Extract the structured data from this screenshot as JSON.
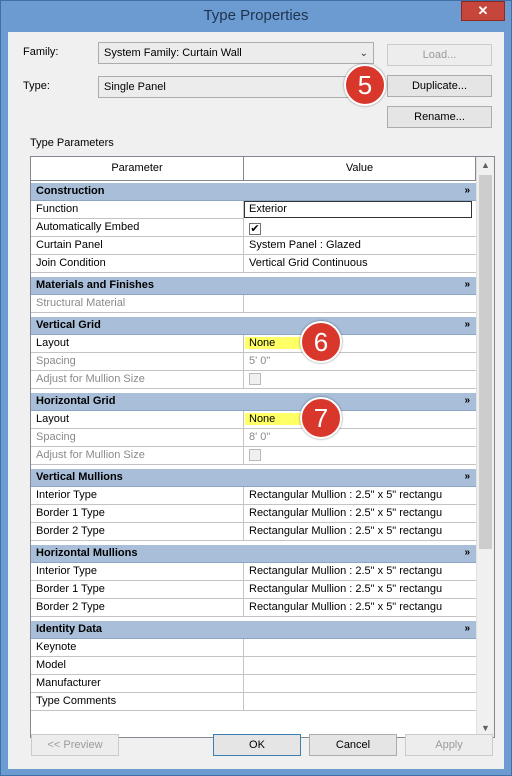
{
  "window": {
    "title": "Type Properties",
    "close_glyph": "✕"
  },
  "family": {
    "label": "Family:",
    "value": "System Family: Curtain Wall",
    "load_label": "Load..."
  },
  "type": {
    "label": "Type:",
    "value": "Single Panel",
    "duplicate_label": "Duplicate...",
    "rename_label": "Rename..."
  },
  "type_parameters_label": "Type Parameters",
  "columns": {
    "parameter": "Parameter",
    "value": "Value"
  },
  "groups": {
    "construction": "Construction",
    "materials": "Materials and Finishes",
    "vgrid": "Vertical Grid",
    "hgrid": "Horizontal Grid",
    "vmullions": "Vertical Mullions",
    "hmullions": "Horizontal Mullions",
    "identity": "Identity Data"
  },
  "rows": {
    "function": {
      "p": "Function",
      "v": "Exterior"
    },
    "auto_embed": {
      "p": "Automatically Embed",
      "v": "✔"
    },
    "curtain_panel": {
      "p": "Curtain Panel",
      "v": "System Panel : Glazed"
    },
    "join_condition": {
      "p": "Join Condition",
      "v": "Vertical Grid Continuous"
    },
    "structural_material": {
      "p": "Structural Material",
      "v": ""
    },
    "vg_layout": {
      "p": "Layout",
      "v": "None"
    },
    "vg_spacing": {
      "p": "Spacing",
      "v": "5'  0\""
    },
    "vg_adjust": {
      "p": "Adjust for Mullion Size",
      "v": ""
    },
    "hg_layout": {
      "p": "Layout",
      "v": "None"
    },
    "hg_spacing": {
      "p": "Spacing",
      "v": "8'  0\""
    },
    "hg_adjust": {
      "p": "Adjust for Mullion Size",
      "v": ""
    },
    "vm_interior": {
      "p": "Interior Type",
      "v": "Rectangular Mullion : 2.5\" x 5\" rectangu"
    },
    "vm_border1": {
      "p": "Border 1 Type",
      "v": "Rectangular Mullion : 2.5\" x 5\" rectangu"
    },
    "vm_border2": {
      "p": "Border 2 Type",
      "v": "Rectangular Mullion : 2.5\" x 5\" rectangu"
    },
    "hm_interior": {
      "p": "Interior Type",
      "v": "Rectangular Mullion : 2.5\" x 5\" rectangu"
    },
    "hm_border1": {
      "p": "Border 1 Type",
      "v": "Rectangular Mullion : 2.5\" x 5\" rectangu"
    },
    "hm_border2": {
      "p": "Border 2 Type",
      "v": "Rectangular Mullion : 2.5\" x 5\" rectangu"
    },
    "keynote": {
      "p": "Keynote",
      "v": ""
    },
    "model": {
      "p": "Model",
      "v": ""
    },
    "manufacturer": {
      "p": "Manufacturer",
      "v": ""
    },
    "type_comments": {
      "p": "Type Comments",
      "v": ""
    }
  },
  "callouts": {
    "five": "5",
    "six": "6",
    "seven": "7"
  },
  "footer": {
    "preview": "<< Preview",
    "ok": "OK",
    "cancel": "Cancel",
    "apply": "Apply"
  },
  "icons": {
    "collapse": "»",
    "scroll_up": "▲",
    "scroll_down": "▼",
    "combo_arrow": "⌄"
  },
  "colors": {
    "group_header": "#a8bed9",
    "highlight": "#ffff66",
    "badge": "#d9372c",
    "frame": "#6b9bd1"
  }
}
